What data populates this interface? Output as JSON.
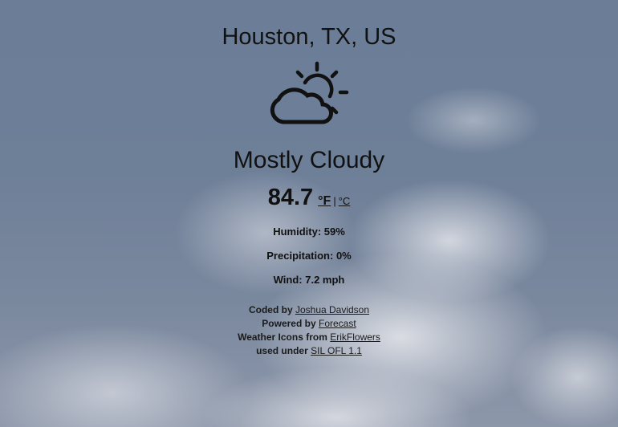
{
  "location": "Houston, TX, US",
  "icon": "day-cloudy-icon",
  "summary": "Mostly Cloudy",
  "temperature": {
    "value": "84.7",
    "unit_f": "°F",
    "separator": "|",
    "unit_c": "°C"
  },
  "stats": {
    "humidity": "Humidity: 59%",
    "precipitation": "Precipitation: 0%",
    "wind": "Wind: 7.2 mph"
  },
  "credits": {
    "coded_prefix": "Coded by",
    "coded_link": "Joshua Davidson",
    "powered_prefix": "Powered by",
    "powered_link": "Forecast",
    "icons_prefix": "Weather Icons from",
    "icons_link": "ErikFlowers",
    "license_prefix": "used under",
    "license_link": "SIL OFL 1.1"
  },
  "colors": {
    "text": "#111111",
    "background": "#6e7f98"
  }
}
